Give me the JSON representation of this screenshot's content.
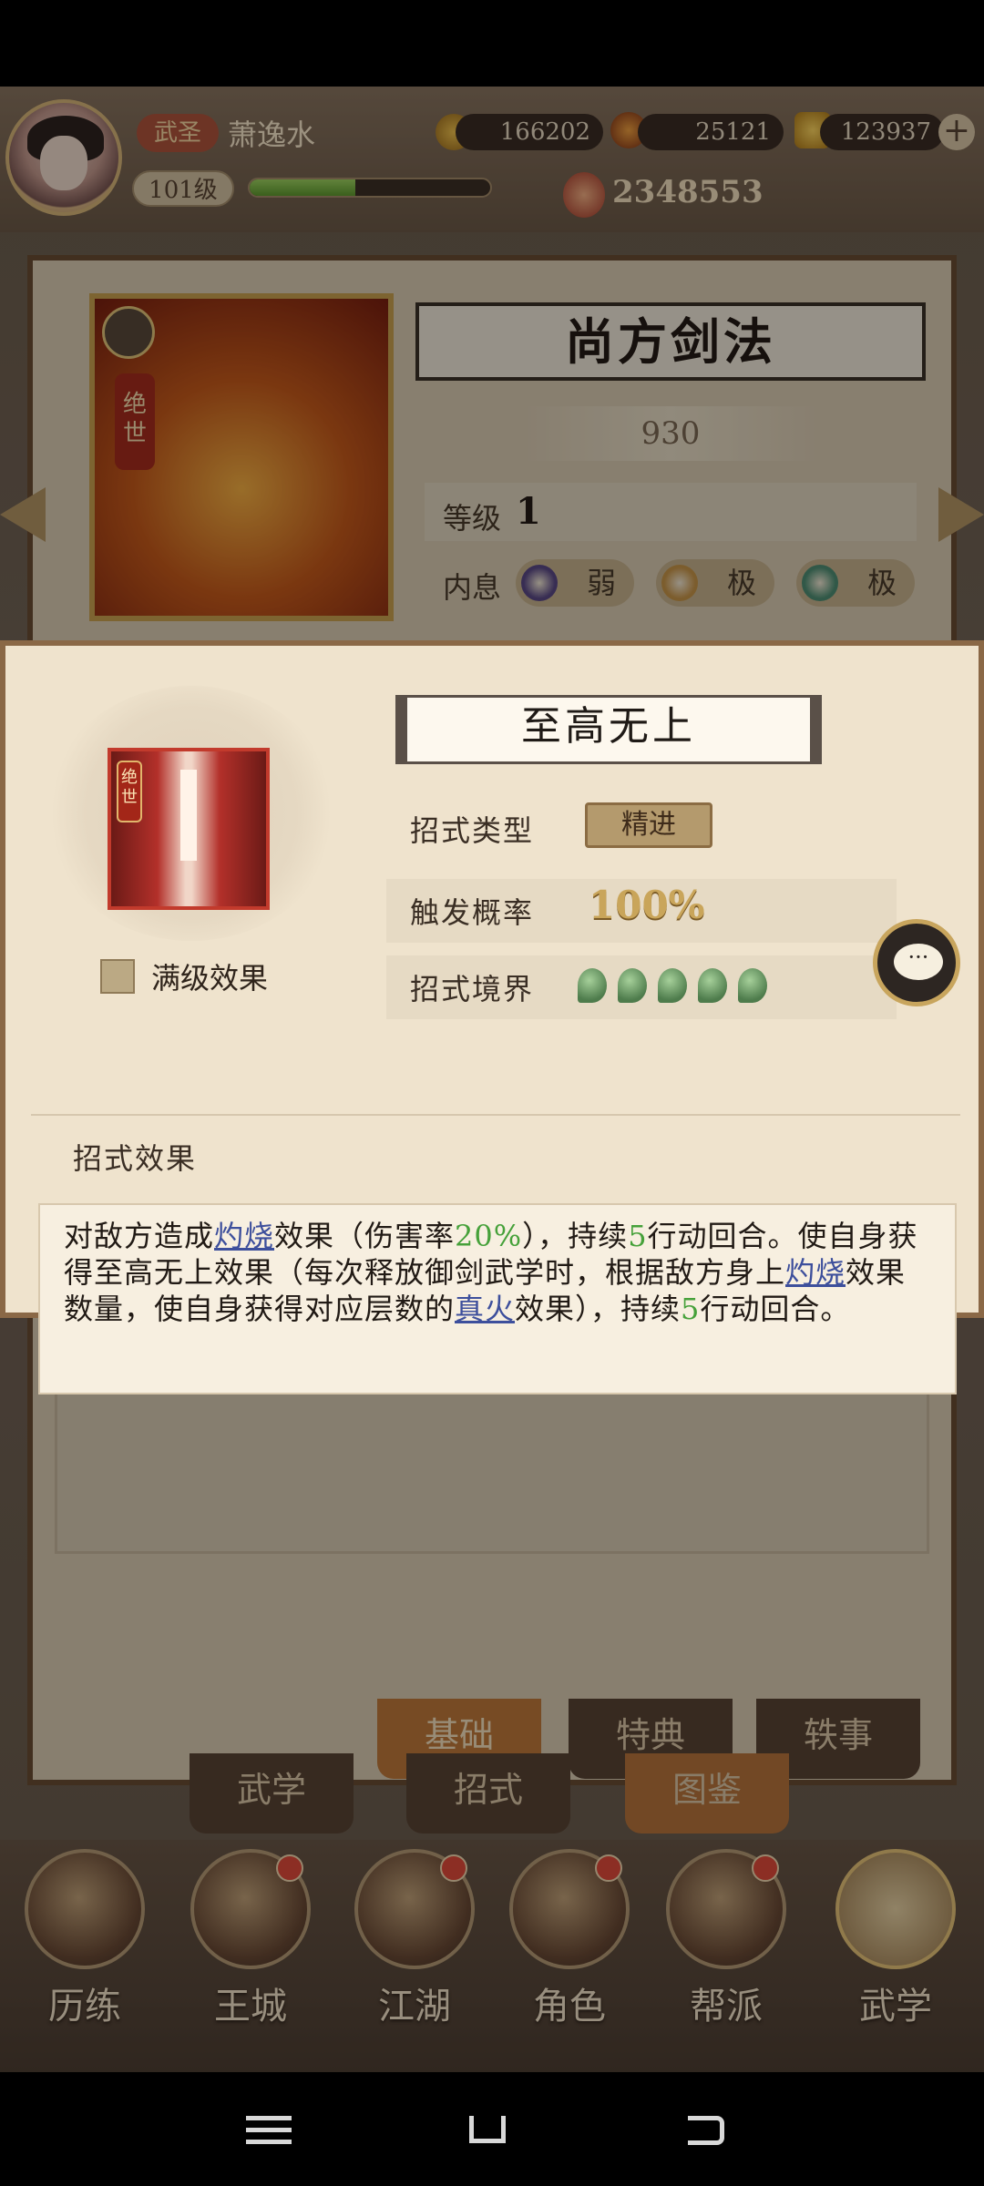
{
  "topbar": {
    "rank_label": "武圣",
    "player_name": "萧逸水",
    "level": "101级",
    "exp_fraction": 0.44,
    "copper": "166202",
    "jade": "25121",
    "gold": "123937",
    "power": "2348553",
    "add_icon": "plus-icon"
  },
  "background_panel": {
    "title": "尚方剑法",
    "power": "930",
    "level_label": "等级",
    "level_value": "1",
    "neixi_label": "内息",
    "neixi": [
      {
        "value": "弱",
        "color": "#5b4a86"
      },
      {
        "value": "极",
        "color": "#c9964a"
      },
      {
        "value": "极",
        "color": "#4f8f74"
      }
    ],
    "card_tag": "绝世"
  },
  "modal": {
    "title": "至高无上",
    "icon_tag": "绝世",
    "full_level_label": "满级效果",
    "type_label": "招式类型",
    "type_value": "精进",
    "rate_label": "触发概率",
    "rate_value": "100%",
    "realm_label": "招式境界",
    "realm_count": 5,
    "effect_header": "招式效果",
    "effect_parts": {
      "p1": "对敌方造成",
      "k1": "灼烧",
      "p2": "效果（伤害率",
      "n1": "20%",
      "p3": "），持续",
      "n2": "5",
      "p4": "行动回合。使自身获得至高无上效果（每次释放御剑武学时，根据敌方身上",
      "k2": "灼烧",
      "p5": "效果数量，使自身获得对应层数的",
      "k3": "真火",
      "p6": "效果），持续",
      "n3": "5",
      "p7": "行动回合。"
    },
    "chat_icon": "chat-bubble-icon",
    "chat_dots": "···"
  },
  "tabs_upper": [
    "基础",
    "特典",
    "轶事"
  ],
  "tabs_lower": [
    "武学",
    "招式",
    "图鉴"
  ],
  "nav": [
    {
      "label": "历练",
      "badge": false
    },
    {
      "label": "王城",
      "badge": true
    },
    {
      "label": "江湖",
      "badge": true
    },
    {
      "label": "角色",
      "badge": true
    },
    {
      "label": "帮派",
      "badge": true
    },
    {
      "label": "武学",
      "badge": false
    }
  ],
  "colors": {
    "accent_green": "#46a13a",
    "keyword_blue": "#3d4f9c",
    "badge_red": "#e24b3a"
  }
}
